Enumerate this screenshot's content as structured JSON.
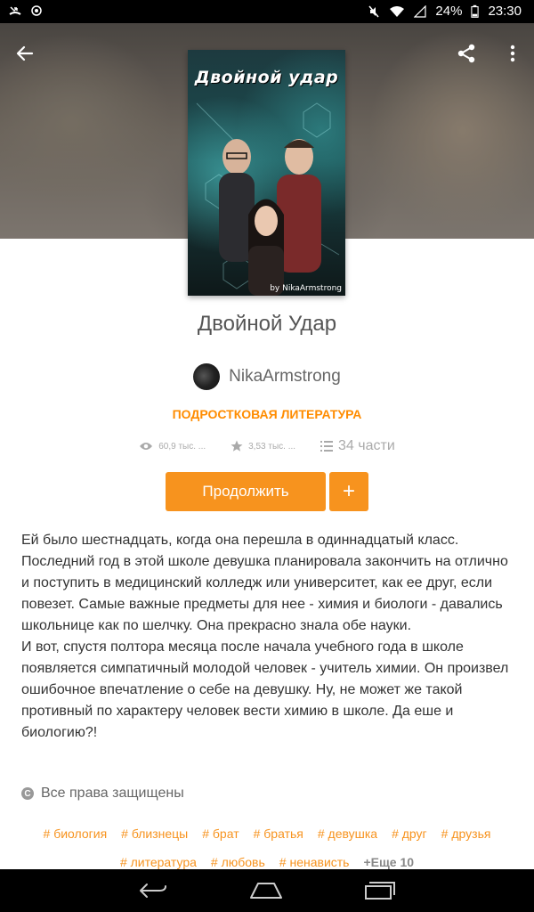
{
  "status_bar": {
    "battery": "24%",
    "time": "23:30"
  },
  "book": {
    "cover_title": "Двойной удар",
    "cover_author": "by NikaArmstrong",
    "title": "Двойной Удар",
    "author": "NikaArmstrong",
    "genre": "ПОДРОСТКОВАЯ ЛИТЕРАТУРА",
    "stats": {
      "reads": "60,9 тыс. ...",
      "votes": "3,53 тыс. ...",
      "parts": "34 части"
    },
    "continue_label": "Продолжить",
    "add_label": "+",
    "description": "Ей было шестнадцать, когда она перешла в одиннадцатый класс. Последний год в этой школе девушка планировала закончить на отлично и поступить в медицинский колледж или университет, как ее друг, если повезет. Самые важные предметы для нее - химия и биологи - давались школьнице как по шелчку. Она прекрасно знала обе науки.\nИ вот, спустя полтора месяца после начала учебного года в школе появляется симпатичный молодой человек - учитель химии. Он произвел ошибочное впечатление о себе на девушку. Ну, не может же такой противный по характеру человек вести химию в школе. Да еше и биологию?!",
    "rights": "Все права защищены",
    "tags": [
      "# биология",
      "# близнецы",
      "# брат",
      "# братья",
      "# девушка",
      "# друг",
      "# друзья",
      "# литература",
      "# любовь",
      "# ненависть"
    ],
    "more_tags": "+Еще 10"
  },
  "colors": {
    "accent": "#f7931e",
    "genre": "#ff8c00"
  }
}
